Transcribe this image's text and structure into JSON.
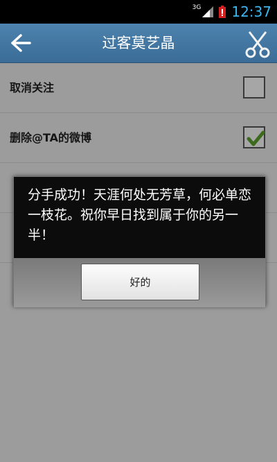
{
  "status_bar": {
    "network": "3G",
    "time": "12:37",
    "icons": [
      "signal-icon",
      "battery-alert-icon"
    ]
  },
  "title_bar": {
    "title": "过客莫艺晶",
    "back_icon": "back-arrow-icon",
    "right_icon": "scissors-icon"
  },
  "list": {
    "items": [
      {
        "label": "取消关注",
        "checked": false
      },
      {
        "label": "删除@TA的微博",
        "checked": true
      },
      {
        "label": "",
        "checked": true
      },
      {
        "label": "",
        "checked": false
      }
    ]
  },
  "dialog": {
    "message": "分手成功！天涯何处无芳草，何必单恋一枝花。祝你早日找到属于你的另一半！",
    "ok_label": "好的"
  },
  "colors": {
    "status_time": "#3cb6f0",
    "title_bar": "#4678a4",
    "check_green": "#5aa02c",
    "dialog_bg": "#0c0c0c"
  }
}
